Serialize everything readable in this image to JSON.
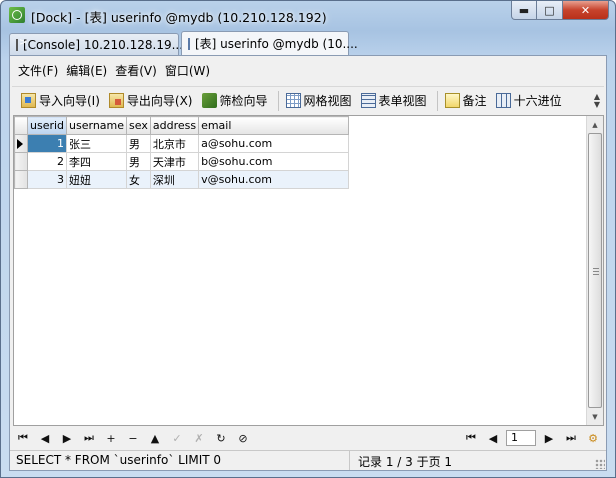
{
  "window": {
    "title": "[Dock] - [表] userinfo @mydb (10.210.128.192)",
    "min_glyph": "▬",
    "max_glyph": "□",
    "close_glyph": "✕"
  },
  "tabs": [
    {
      "label": "[Console] 10.210.128.19...",
      "icon": "console-icon"
    },
    {
      "label": "[表] userinfo @mydb (10....",
      "icon": "table-icon"
    }
  ],
  "menu": [
    "文件(F)",
    "编辑(E)",
    "查看(V)",
    "窗口(W)"
  ],
  "toolbar": {
    "import": "导入向导(I)",
    "export": "导出向导(X)",
    "filter": "筛检向导",
    "grid_view": "网格视图",
    "form_view": "表单视图",
    "memo": "备注",
    "hex": "十六进位"
  },
  "grid": {
    "columns": [
      "userid",
      "username",
      "sex",
      "address",
      "email"
    ],
    "rows": [
      {
        "userid": "1",
        "username": "张三",
        "sex": "男",
        "address": "北京市",
        "email": "a@sohu.com"
      },
      {
        "userid": "2",
        "username": "李四",
        "sex": "男",
        "address": "天津市",
        "email": "b@sohu.com"
      },
      {
        "userid": "3",
        "username": "妞妞",
        "sex": "女",
        "address": "深圳",
        "email": "v@sohu.com"
      }
    ]
  },
  "navigator": {
    "first": "⏮",
    "prev": "◀",
    "next": "▶",
    "last": "⏭",
    "add": "+",
    "delete": "−",
    "up": "▲",
    "apply": "✓",
    "cancel": "✗",
    "refresh": "↻",
    "stop": "⊘",
    "page": "1"
  },
  "status": {
    "sql": "SELECT * FROM `userinfo` LIMIT 0",
    "record": "记录 1 / 3 于页 1"
  }
}
